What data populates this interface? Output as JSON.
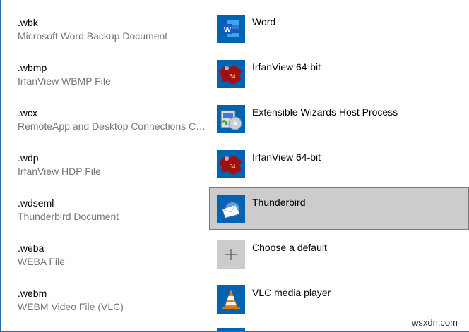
{
  "rows": [
    {
      "ext": ".wbk",
      "desc": "Microsoft Word Backup Document",
      "app": "Word",
      "icon": "word-icon"
    },
    {
      "ext": ".wbmp",
      "desc": "IrfanView WBMP File",
      "app": "IrfanView 64-bit",
      "icon": "irfanview-icon"
    },
    {
      "ext": ".wcx",
      "desc": "RemoteApp and Desktop Connections Co...",
      "app": "Extensible Wizards Host Process",
      "icon": "wizard-icon"
    },
    {
      "ext": ".wdp",
      "desc": "IrfanView HDP File",
      "app": "IrfanView 64-bit",
      "icon": "irfanview-icon"
    },
    {
      "ext": ".wdseml",
      "desc": "Thunderbird Document",
      "app": "Thunderbird",
      "icon": "thunderbird-icon",
      "selected": true
    },
    {
      "ext": ".weba",
      "desc": "WEBA File",
      "app": "Choose a default",
      "icon": "plus-icon"
    },
    {
      "ext": ".webm",
      "desc": "WEBM Video File (VLC)",
      "app": "VLC media player",
      "icon": "vlc-icon"
    }
  ],
  "watermark": "wsxdn.com",
  "colors": {
    "selected_bg": "#cccccc",
    "icon_bg": "#0063b1",
    "accent": "#2b6cb0"
  }
}
